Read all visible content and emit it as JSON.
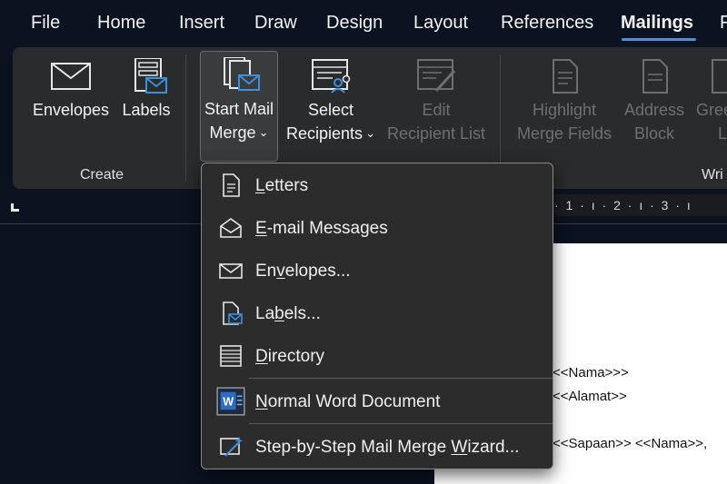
{
  "tabs": [
    {
      "label": "File"
    },
    {
      "label": "Home"
    },
    {
      "label": "Insert"
    },
    {
      "label": "Draw"
    },
    {
      "label": "Design"
    },
    {
      "label": "Layout"
    },
    {
      "label": "References"
    },
    {
      "label": "Mailings"
    },
    {
      "label": "F"
    }
  ],
  "active_tab": "Mailings",
  "ribbon": {
    "create_group_label": "Create",
    "write_group_label": "Wri",
    "envelopes_label": "Envelopes",
    "labels_label": "Labels",
    "start_mail_merge_line1": "Start Mail",
    "start_mail_merge_line2": "Merge",
    "select_recipients_line1": "Select",
    "select_recipients_line2": "Recipients",
    "edit_recipient_list_line1": "Edit",
    "edit_recipient_list_line2": "Recipient List",
    "highlight_merge_fields_line1": "Highlight",
    "highlight_merge_fields_line2": "Merge Fields",
    "address_block_line1": "Address",
    "address_block_line2": "Block",
    "greeting_line_line1": "Gree",
    "greeting_line_line2": "Li",
    "chevron": "⌄"
  },
  "ruler": {
    "text": "· 1 · ı · 2 · ı · 3 · ı"
  },
  "menu": {
    "items": [
      {
        "pre": "",
        "key": "L",
        "post": "etters",
        "icon": "letter-page-icon"
      },
      {
        "pre": "",
        "key": "E",
        "post": "-mail Messages",
        "icon": "open-envelope-icon"
      },
      {
        "pre": "En",
        "key": "v",
        "post": "elopes...",
        "icon": "envelope-icon"
      },
      {
        "pre": "La",
        "key": "b",
        "post": "els...",
        "icon": "label-page-icon"
      },
      {
        "pre": "",
        "key": "D",
        "post": "irectory",
        "icon": "directory-list-icon"
      },
      {
        "pre": "",
        "key": "N",
        "post": "ormal Word Document",
        "icon": "word-document-icon"
      },
      {
        "pre": "Step-by-Step Mail Merge ",
        "key": "W",
        "post": "izard...",
        "icon": "wizard-wand-icon"
      }
    ]
  },
  "document": {
    "lines": [
      "<<Nama>>>",
      "<<Alamat>>",
      "<<Sapaan>> <<Nama>>,"
    ]
  },
  "colors": {
    "accent": "#4f8fe0",
    "icon_blue": "#3d8fd8",
    "ribbon": "#2a2b2d",
    "background": "#0b1220"
  }
}
